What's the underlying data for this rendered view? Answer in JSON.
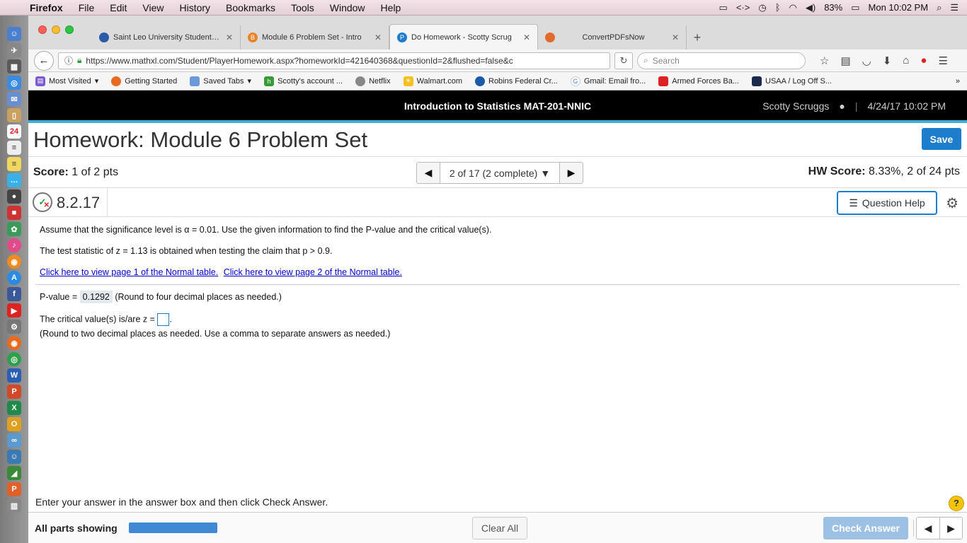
{
  "menubar": {
    "app": "Firefox",
    "items": [
      "File",
      "Edit",
      "View",
      "History",
      "Bookmarks",
      "Tools",
      "Window",
      "Help"
    ],
    "battery": "83%",
    "clock": "Mon 10:02 PM"
  },
  "tabs": [
    {
      "title": "Saint Leo University Students Ho",
      "fav_color": "#2a5aa8"
    },
    {
      "title": "Module 6 Problem Set - Intro",
      "fav_color": "#e8832a",
      "fav_char": "B"
    },
    {
      "title": "Do Homework - Scotty Scrug",
      "fav_color": "#1b7dcc",
      "fav_char": "P"
    },
    {
      "title": "ConvertPDFsNow",
      "fav_color": "#e26a2c"
    }
  ],
  "url": "https://www.mathxl.com/Student/PlayerHomework.aspx?homeworkId=421640368&questionId=2&flushed=false&c",
  "search_placeholder": "Search",
  "bookmarks": [
    "Most Visited",
    "Getting Started",
    "Saved Tabs",
    "Scotty's account ...",
    "Netflix",
    "Walmart.com",
    "Robins Federal Cr...",
    "Gmail: Email fro...",
    "Armed Forces Ba...",
    "USAA / Log Off S..."
  ],
  "header": {
    "course": "Introduction to Statistics MAT-201-NNIC",
    "user": "Scotty Scruggs",
    "datetime": "4/24/17 10:02 PM"
  },
  "title": "Homework: Module 6 Problem Set",
  "save_label": "Save",
  "score": {
    "label": "Score:",
    "value": "1 of 2 pts"
  },
  "question_nav": "2 of 17 (2 complete)",
  "hw_score": {
    "label": "HW Score:",
    "value": "8.33%, 2 of 24 pts"
  },
  "question_number": "8.2.17",
  "question_help": "Question Help",
  "question": {
    "line1": "Assume that the significance level is α = 0.01. Use the given information to find the P-value and the critical value(s).",
    "line2": "The test statistic of z = 1.13 is obtained when testing the claim that p > 0.9.",
    "link1": "Click here to view page 1 of the Normal table.",
    "link2": "Click here to view page 2 of the Normal table.",
    "pvalue_label": "P-value =",
    "pvalue": "0.1292",
    "pvalue_hint": "(Round to four decimal places as needed.)",
    "critical_label": "The critical value(s) is/are z =",
    "critical_hint": "(Round to two decimal places as needed. Use a comma to separate answers as needed.)"
  },
  "instruction": "Enter your answer in the answer box and then click Check Answer.",
  "all_parts": "All parts showing",
  "clear_all": "Clear All",
  "check_answer": "Check Answer"
}
